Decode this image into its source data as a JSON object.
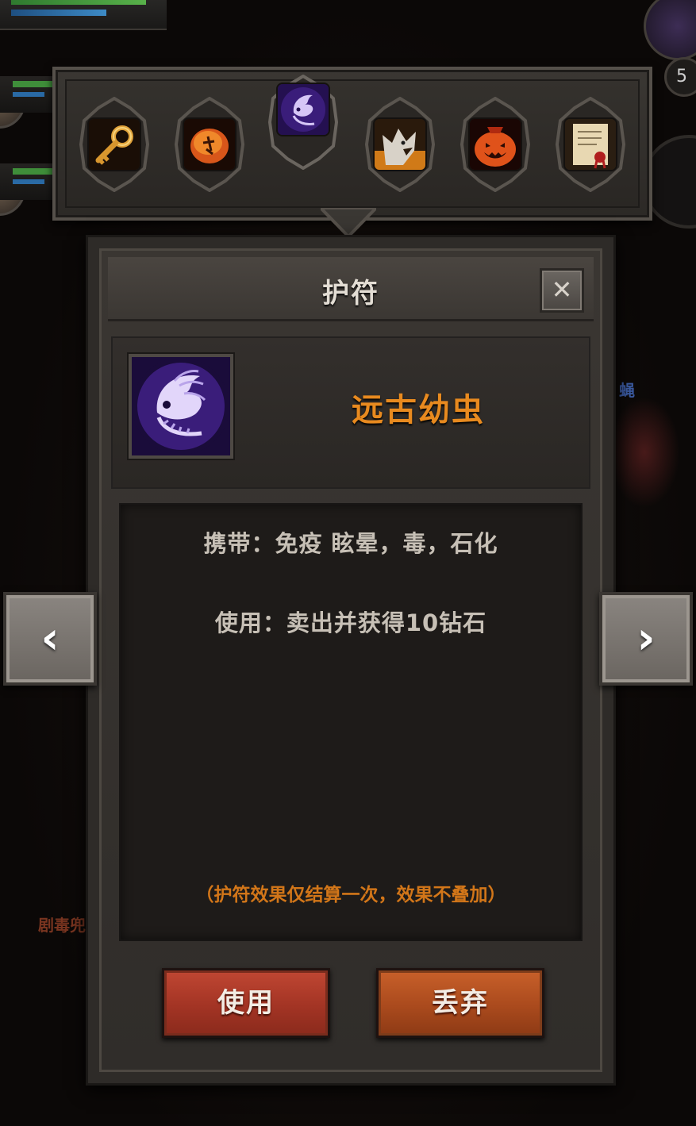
{
  "hud": {
    "right_badge_number": "5"
  },
  "background_labels": {
    "left_enemy_name": "剧毒兜",
    "right_enemy_name": "蝇"
  },
  "item_bar": {
    "slots": [
      {
        "icon": "golden-key-icon"
      },
      {
        "icon": "amber-insect-icon"
      },
      {
        "icon": "ancient-larva-icon",
        "selected": true
      },
      {
        "icon": "wolf-head-icon"
      },
      {
        "icon": "pumpkin-bag-icon"
      },
      {
        "icon": "scroll-icon"
      }
    ]
  },
  "dialog": {
    "title": "护符",
    "close_glyph": "✕",
    "item_name": "远古幼虫",
    "carry_text": "携带：免疫 眩晕，毒，石化",
    "use_text": "使用：卖出并获得10钻石",
    "note_text": "（护符效果仅结算一次，效果不叠加）",
    "use_button": "使用",
    "discard_button": "丢弃"
  },
  "nav": {
    "prev_glyph": "‹",
    "next_glyph": "›"
  },
  "colors": {
    "item_name": "#e88a1f",
    "note": "#d27619",
    "use_button": "#a33424",
    "discard_button": "#aa4a1d"
  }
}
